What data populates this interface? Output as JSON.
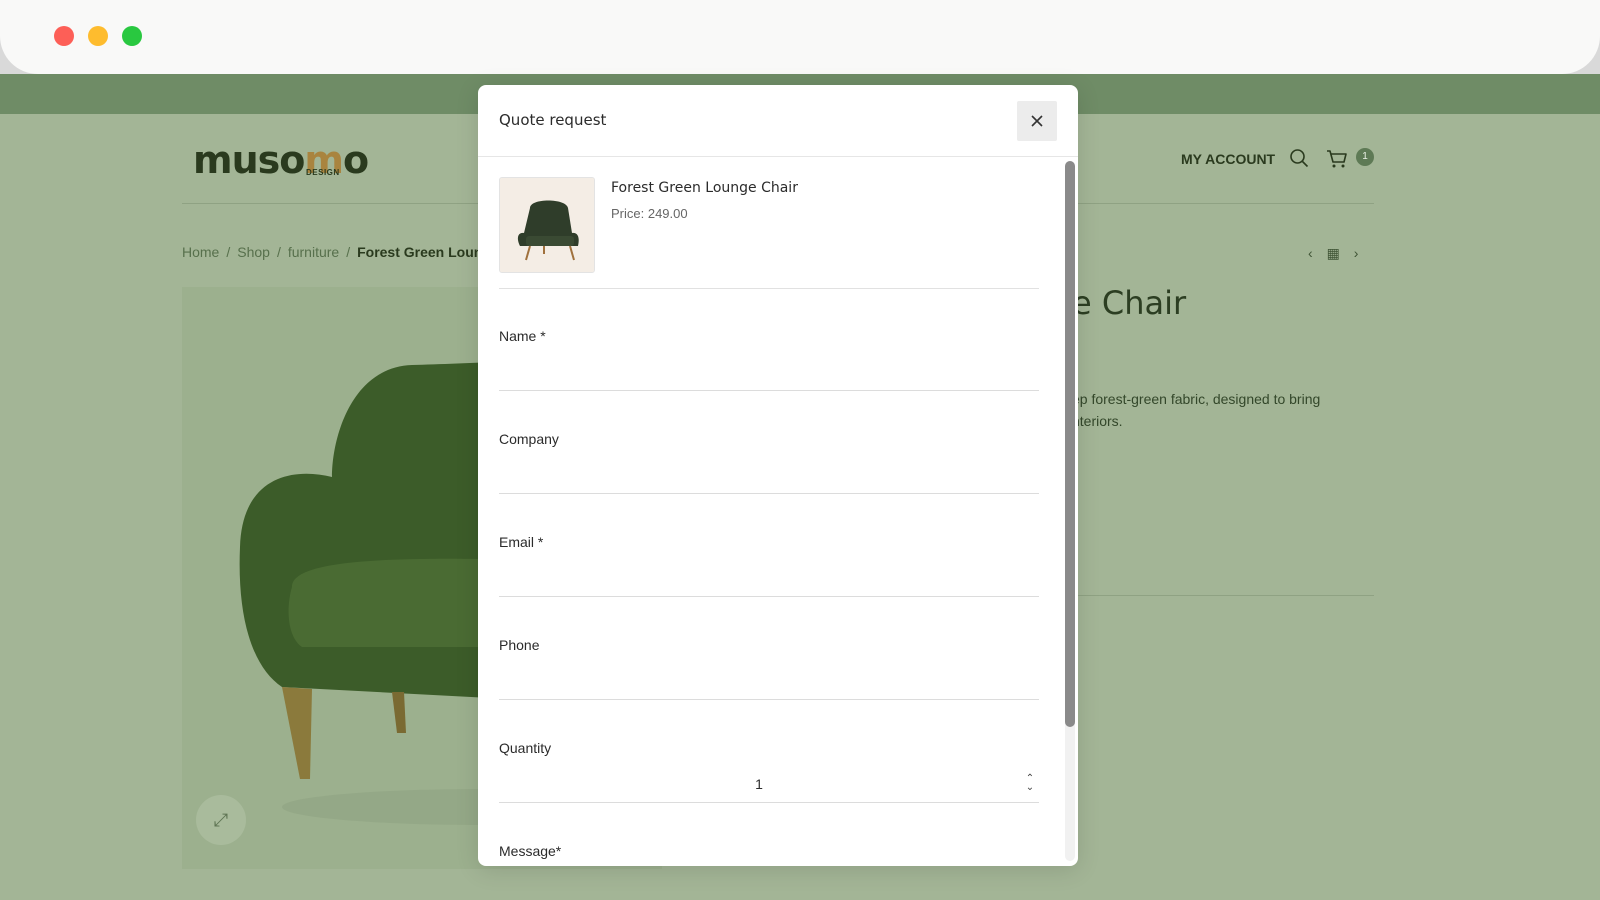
{
  "site": {
    "logo_text_left": "muso",
    "logo_text_accent": "m",
    "logo_text_right": "o",
    "logo_sub": "DESIGN",
    "my_account": "MY ACCOUNT",
    "cart_count": "1"
  },
  "breadcrumb": {
    "home": "Home",
    "shop": "Shop",
    "category": "furniture",
    "current": "Forest Green Lounge Chair"
  },
  "background_product": {
    "title_fragment": "e Chair",
    "desc_line1": "ep forest-green fabric, designed to bring",
    "desc_line2": "nteriors."
  },
  "modal": {
    "title": "Quote request",
    "product_name": "Forest Green Lounge Chair",
    "product_price": "Price: 249.00",
    "fields": {
      "name_label": "Name *",
      "company_label": "Company",
      "email_label": "Email *",
      "phone_label": "Phone",
      "quantity_label": "Quantity",
      "quantity_value": "1",
      "message_label": "Message*"
    }
  },
  "colors": {
    "page_overlay": "#a3b596",
    "top_strip": "#6f8c66",
    "modal_bg": "#ffffff"
  }
}
